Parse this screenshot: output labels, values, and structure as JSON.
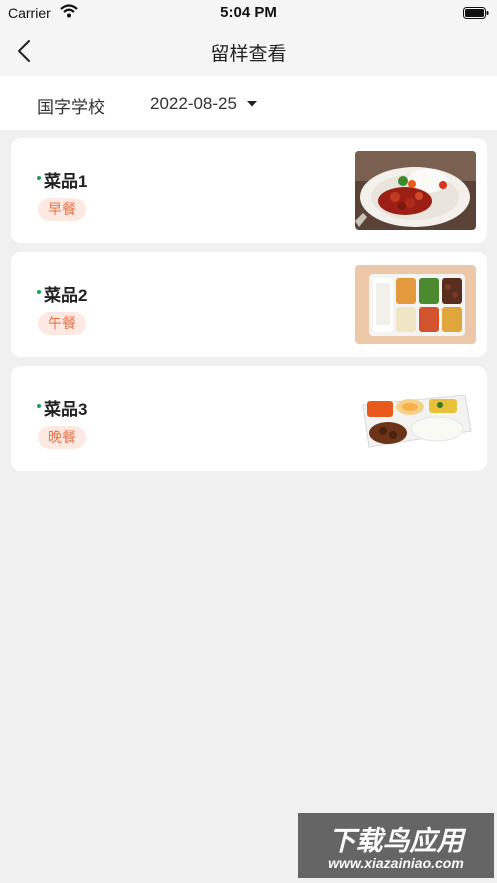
{
  "status_bar": {
    "carrier": "Carrier",
    "time": "5:04 PM"
  },
  "nav": {
    "title": "留样查看",
    "back_icon": "chevron-left-icon"
  },
  "filter": {
    "school": "国字学校",
    "date": "2022-08-25",
    "dropdown_icon": "caret-down-icon"
  },
  "items": [
    {
      "name": "菜品1",
      "meal": "早餐"
    },
    {
      "name": "菜品2",
      "meal": "午餐"
    },
    {
      "name": "菜品3",
      "meal": "晚餐"
    }
  ],
  "colors": {
    "background": "#f0f0f0",
    "card": "#ffffff",
    "tag_bg": "#fde9e1",
    "tag_text": "#e8724a",
    "dot": "#1aa05a"
  },
  "watermark": {
    "title": "下载鸟应用",
    "url": "www.xiazainiao.com"
  }
}
